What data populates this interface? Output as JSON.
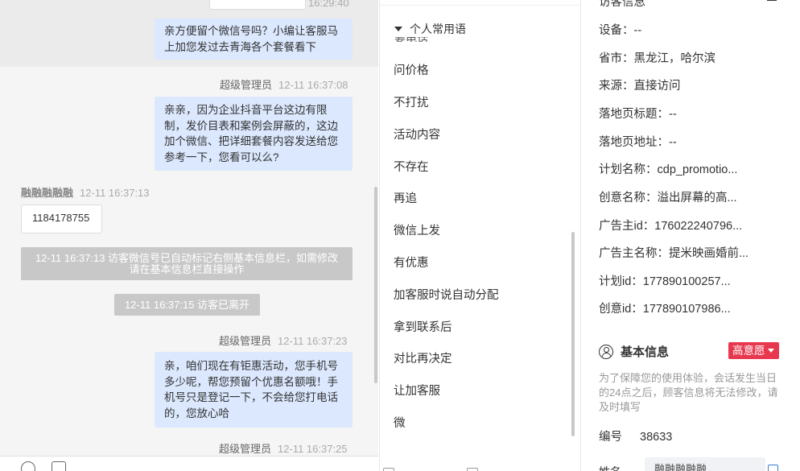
{
  "chat": {
    "top_time": "16:29:40",
    "msg1": "亲方便留个微信号吗？小编让客服马上加您发过去青海各个套餐看下",
    "sender": "超级管理员",
    "msg2_time": "12-11 16:37:08",
    "msg2": "亲亲，因为企业抖音平台这边有限制，发价目表和案例会屏蔽的，这边加个微信、把详细套餐内容发送给您参考一下，您看可以么?",
    "visitor_name": "融融融融融",
    "visitor_time": "12-11 16:37:13",
    "visitor_msg": "1184178755",
    "sys1": "12-11 16:37:13 访客微信号已自动标记右侧基本信息栏，如需修改请在基本信息栏直接操作",
    "sys2": "12-11 16:37:15 访客已离开",
    "msg3_time": "12-11 16:37:23",
    "msg3": "亲，咱们现在有钜惠活动，您手机号多少呢，帮您预留个优惠名额哦！手机号只是登记一下，不会给您打电话的，您放心哈",
    "msg4_time": "12-11 16:37:25"
  },
  "phrases": {
    "header": "个人常用语",
    "peek": "要电话",
    "items": [
      "问价格",
      "不打扰",
      "活动内容",
      "不存在",
      "再追",
      "微信上发",
      "有优惠",
      "加客服时说自动分配",
      "拿到联系后",
      "对比再决定",
      "让加客服",
      "微"
    ]
  },
  "info": {
    "top_partial": "访客信息",
    "rows": [
      {
        "k": "设备：",
        "v": "--"
      },
      {
        "k": "省市：",
        "v": "黑龙江，哈尔滨"
      },
      {
        "k": "来源：",
        "v": "直接访问"
      },
      {
        "k": "落地页标题：",
        "v": "--"
      },
      {
        "k": "落地页地址：",
        "v": "--"
      },
      {
        "k": "计划名称：",
        "v": "cdp_promotio..."
      },
      {
        "k": "创意名称：",
        "v": "溢出屏幕的高..."
      },
      {
        "k": "广告主id：",
        "v": "176022240796..."
      },
      {
        "k": "广告主名称：",
        "v": "提米映画婚前..."
      },
      {
        "k": "计划id：",
        "v": "177890100257..."
      },
      {
        "k": "创意id：",
        "v": "177890107986..."
      }
    ],
    "basic_title": "基本信息",
    "intent": "高意愿",
    "notice": "为了保障您的使用体验，会话发生当日的24点之后，顾客信息将无法修改，请及时填写",
    "id_label": "编号",
    "id_value": "38633",
    "name_label": "姓名",
    "name_value": "融融融融融"
  }
}
